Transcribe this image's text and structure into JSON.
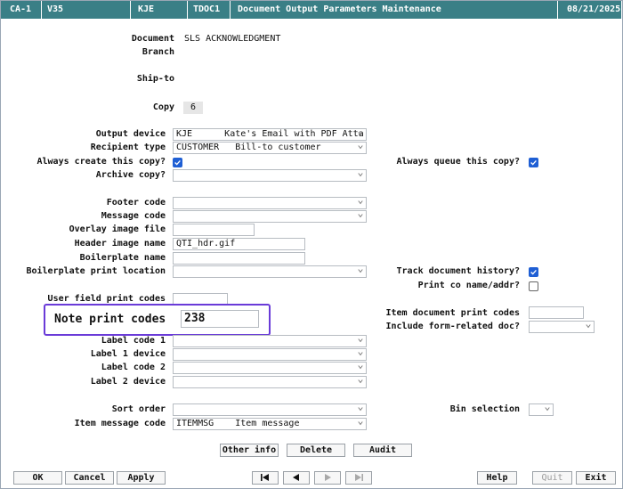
{
  "titlebar": {
    "session": "CA-1",
    "version": "V35",
    "user": "KJE",
    "program": "TDOC1",
    "title": "Document Output Parameters Maintenance",
    "date": "08/21/2025"
  },
  "form": {
    "document_label": "Document",
    "document_value": "SLS ACKNOWLEDGMENT",
    "branch_label": "Branch",
    "shipto_label": "Ship-to",
    "copy_label": "Copy",
    "copy_value": "6",
    "output_device_label": "Output device",
    "output_device_value": "KJE      Kate's Email with PDF Atta",
    "recipient_type_label": "Recipient type",
    "recipient_type_value": "CUSTOMER   Bill-to customer",
    "always_create_label": "Always create this copy?",
    "always_create_checked": true,
    "always_queue_label": "Always queue this copy?",
    "always_queue_checked": true,
    "archive_copy_label": "Archive copy?",
    "footer_code_label": "Footer code",
    "message_code_label": "Message code",
    "overlay_image_label": "Overlay image file",
    "header_image_label": "Header image name",
    "header_image_value": "QTI_hdr.gif",
    "boilerplate_name_label": "Boilerplate name",
    "boilerplate_loc_label": "Boilerplate print location",
    "track_history_label": "Track document history?",
    "track_history_checked": true,
    "print_co_name_label": "Print co name/addr?",
    "print_co_name_checked": false,
    "user_field_label": "User field print codes",
    "note_print_label": "Note print codes",
    "note_print_value": "238",
    "item_doc_print_label": "Item document print codes",
    "include_form_label": "Include form-related doc?",
    "label_code1_label": "Label code 1",
    "label1_device_label": "Label 1 device",
    "label_code2_label": "Label code 2",
    "label2_device_label": "Label 2 device",
    "sort_order_label": "Sort order",
    "bin_selection_label": "Bin selection",
    "item_message_label": "Item message code",
    "item_message_value": "ITEMMSG    Item message"
  },
  "actions": {
    "other_info": "Other info",
    "delete": "Delete",
    "audit": "Audit"
  },
  "footer": {
    "ok": "OK",
    "cancel": "Cancel",
    "apply": "Apply",
    "help": "Help",
    "quit": "Quit",
    "exit": "Exit"
  },
  "icons": {
    "first": "first-page-icon",
    "prev": "previous-icon",
    "next": "next-icon",
    "last": "last-page-icon",
    "dropdown": "chevron-down-icon",
    "checkbox": "checkmark-icon"
  },
  "colors": {
    "titlebar": "#3a7f86",
    "checkbox_on": "#1f5fd4",
    "highlight": "#6a3bd8"
  }
}
